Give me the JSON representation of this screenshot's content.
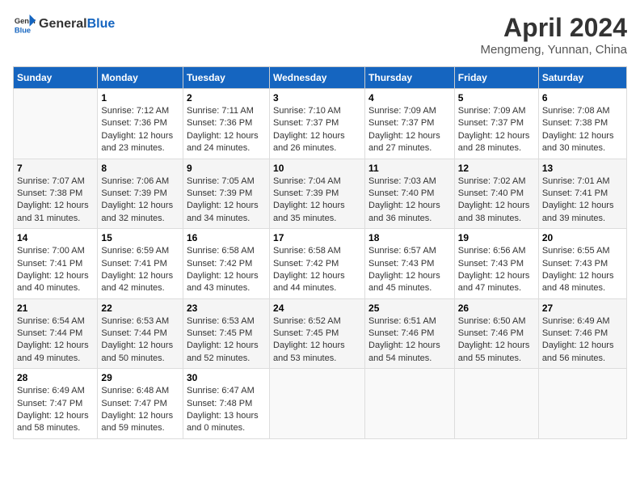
{
  "header": {
    "logo_general": "General",
    "logo_blue": "Blue",
    "title": "April 2024",
    "subtitle": "Mengmeng, Yunnan, China"
  },
  "days_of_week": [
    "Sunday",
    "Monday",
    "Tuesday",
    "Wednesday",
    "Thursday",
    "Friday",
    "Saturday"
  ],
  "weeks": [
    [
      {
        "day": "",
        "sunrise": "",
        "sunset": "",
        "daylight": ""
      },
      {
        "day": "1",
        "sunrise": "Sunrise: 7:12 AM",
        "sunset": "Sunset: 7:36 PM",
        "daylight": "Daylight: 12 hours and 23 minutes."
      },
      {
        "day": "2",
        "sunrise": "Sunrise: 7:11 AM",
        "sunset": "Sunset: 7:36 PM",
        "daylight": "Daylight: 12 hours and 24 minutes."
      },
      {
        "day": "3",
        "sunrise": "Sunrise: 7:10 AM",
        "sunset": "Sunset: 7:37 PM",
        "daylight": "Daylight: 12 hours and 26 minutes."
      },
      {
        "day": "4",
        "sunrise": "Sunrise: 7:09 AM",
        "sunset": "Sunset: 7:37 PM",
        "daylight": "Daylight: 12 hours and 27 minutes."
      },
      {
        "day": "5",
        "sunrise": "Sunrise: 7:09 AM",
        "sunset": "Sunset: 7:37 PM",
        "daylight": "Daylight: 12 hours and 28 minutes."
      },
      {
        "day": "6",
        "sunrise": "Sunrise: 7:08 AM",
        "sunset": "Sunset: 7:38 PM",
        "daylight": "Daylight: 12 hours and 30 minutes."
      }
    ],
    [
      {
        "day": "7",
        "sunrise": "Sunrise: 7:07 AM",
        "sunset": "Sunset: 7:38 PM",
        "daylight": "Daylight: 12 hours and 31 minutes."
      },
      {
        "day": "8",
        "sunrise": "Sunrise: 7:06 AM",
        "sunset": "Sunset: 7:39 PM",
        "daylight": "Daylight: 12 hours and 32 minutes."
      },
      {
        "day": "9",
        "sunrise": "Sunrise: 7:05 AM",
        "sunset": "Sunset: 7:39 PM",
        "daylight": "Daylight: 12 hours and 34 minutes."
      },
      {
        "day": "10",
        "sunrise": "Sunrise: 7:04 AM",
        "sunset": "Sunset: 7:39 PM",
        "daylight": "Daylight: 12 hours and 35 minutes."
      },
      {
        "day": "11",
        "sunrise": "Sunrise: 7:03 AM",
        "sunset": "Sunset: 7:40 PM",
        "daylight": "Daylight: 12 hours and 36 minutes."
      },
      {
        "day": "12",
        "sunrise": "Sunrise: 7:02 AM",
        "sunset": "Sunset: 7:40 PM",
        "daylight": "Daylight: 12 hours and 38 minutes."
      },
      {
        "day": "13",
        "sunrise": "Sunrise: 7:01 AM",
        "sunset": "Sunset: 7:41 PM",
        "daylight": "Daylight: 12 hours and 39 minutes."
      }
    ],
    [
      {
        "day": "14",
        "sunrise": "Sunrise: 7:00 AM",
        "sunset": "Sunset: 7:41 PM",
        "daylight": "Daylight: 12 hours and 40 minutes."
      },
      {
        "day": "15",
        "sunrise": "Sunrise: 6:59 AM",
        "sunset": "Sunset: 7:41 PM",
        "daylight": "Daylight: 12 hours and 42 minutes."
      },
      {
        "day": "16",
        "sunrise": "Sunrise: 6:58 AM",
        "sunset": "Sunset: 7:42 PM",
        "daylight": "Daylight: 12 hours and 43 minutes."
      },
      {
        "day": "17",
        "sunrise": "Sunrise: 6:58 AM",
        "sunset": "Sunset: 7:42 PM",
        "daylight": "Daylight: 12 hours and 44 minutes."
      },
      {
        "day": "18",
        "sunrise": "Sunrise: 6:57 AM",
        "sunset": "Sunset: 7:43 PM",
        "daylight": "Daylight: 12 hours and 45 minutes."
      },
      {
        "day": "19",
        "sunrise": "Sunrise: 6:56 AM",
        "sunset": "Sunset: 7:43 PM",
        "daylight": "Daylight: 12 hours and 47 minutes."
      },
      {
        "day": "20",
        "sunrise": "Sunrise: 6:55 AM",
        "sunset": "Sunset: 7:43 PM",
        "daylight": "Daylight: 12 hours and 48 minutes."
      }
    ],
    [
      {
        "day": "21",
        "sunrise": "Sunrise: 6:54 AM",
        "sunset": "Sunset: 7:44 PM",
        "daylight": "Daylight: 12 hours and 49 minutes."
      },
      {
        "day": "22",
        "sunrise": "Sunrise: 6:53 AM",
        "sunset": "Sunset: 7:44 PM",
        "daylight": "Daylight: 12 hours and 50 minutes."
      },
      {
        "day": "23",
        "sunrise": "Sunrise: 6:53 AM",
        "sunset": "Sunset: 7:45 PM",
        "daylight": "Daylight: 12 hours and 52 minutes."
      },
      {
        "day": "24",
        "sunrise": "Sunrise: 6:52 AM",
        "sunset": "Sunset: 7:45 PM",
        "daylight": "Daylight: 12 hours and 53 minutes."
      },
      {
        "day": "25",
        "sunrise": "Sunrise: 6:51 AM",
        "sunset": "Sunset: 7:46 PM",
        "daylight": "Daylight: 12 hours and 54 minutes."
      },
      {
        "day": "26",
        "sunrise": "Sunrise: 6:50 AM",
        "sunset": "Sunset: 7:46 PM",
        "daylight": "Daylight: 12 hours and 55 minutes."
      },
      {
        "day": "27",
        "sunrise": "Sunrise: 6:49 AM",
        "sunset": "Sunset: 7:46 PM",
        "daylight": "Daylight: 12 hours and 56 minutes."
      }
    ],
    [
      {
        "day": "28",
        "sunrise": "Sunrise: 6:49 AM",
        "sunset": "Sunset: 7:47 PM",
        "daylight": "Daylight: 12 hours and 58 minutes."
      },
      {
        "day": "29",
        "sunrise": "Sunrise: 6:48 AM",
        "sunset": "Sunset: 7:47 PM",
        "daylight": "Daylight: 12 hours and 59 minutes."
      },
      {
        "day": "30",
        "sunrise": "Sunrise: 6:47 AM",
        "sunset": "Sunset: 7:48 PM",
        "daylight": "Daylight: 13 hours and 0 minutes."
      },
      {
        "day": "",
        "sunrise": "",
        "sunset": "",
        "daylight": ""
      },
      {
        "day": "",
        "sunrise": "",
        "sunset": "",
        "daylight": ""
      },
      {
        "day": "",
        "sunrise": "",
        "sunset": "",
        "daylight": ""
      },
      {
        "day": "",
        "sunrise": "",
        "sunset": "",
        "daylight": ""
      }
    ]
  ]
}
